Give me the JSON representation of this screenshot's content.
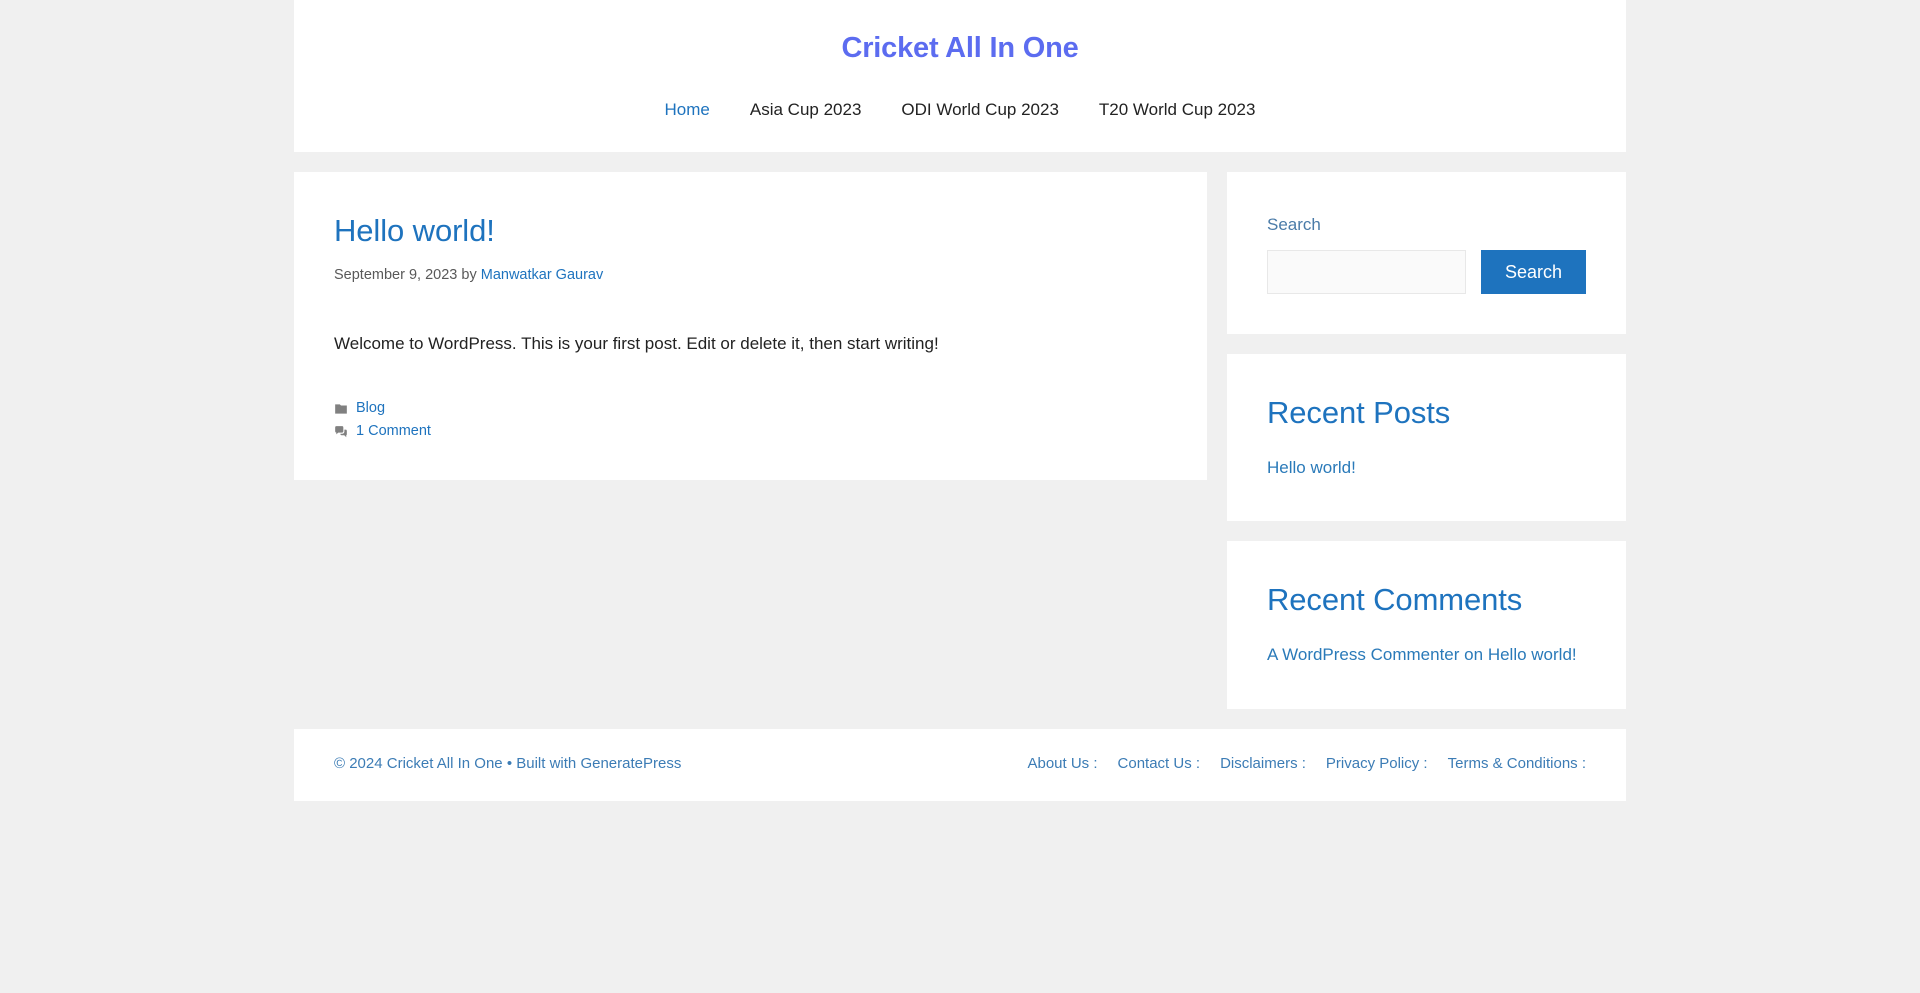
{
  "header": {
    "site_title": "Cricket All In One",
    "nav": [
      {
        "label": "Home",
        "active": true
      },
      {
        "label": "Asia Cup 2023",
        "active": false
      },
      {
        "label": "ODI World Cup 2023",
        "active": false
      },
      {
        "label": "T20 World Cup 2023",
        "active": false
      }
    ]
  },
  "post": {
    "title": "Hello world!",
    "date": "September 9, 2023",
    "by_label": "by",
    "author": "Manwatkar Gaurav",
    "content": "Welcome to WordPress. This is your first post. Edit or delete it, then start writing!",
    "category_icon": "folder-icon",
    "category": "Blog",
    "comments_icon": "comments-icon",
    "comments": "1 Comment"
  },
  "sidebar": {
    "search": {
      "label": "Search",
      "value": "",
      "placeholder": "",
      "button_label": "Search",
      "button_color": "#1e73be"
    },
    "recent_posts": {
      "title": "Recent Posts",
      "items": [
        {
          "label": "Hello world!"
        }
      ]
    },
    "recent_comments": {
      "title": "Recent Comments",
      "items": [
        {
          "author": "A WordPress Commenter",
          "separator": "on",
          "post": "Hello world!"
        }
      ]
    }
  },
  "footer": {
    "copyright": "© 2024 Cricket All In One",
    "bullet": "•",
    "built_with": "Built with",
    "builder": "GeneratePress",
    "nav": [
      {
        "label": "About Us :"
      },
      {
        "label": "Contact Us :"
      },
      {
        "label": "Disclaimers :"
      },
      {
        "label": "Privacy Policy :"
      },
      {
        "label": "Terms & Conditions :"
      }
    ]
  },
  "colors": {
    "site_title": "#5c6cf0",
    "link": "#1e73be",
    "page_background": "#f0f0f0",
    "card_background": "#ffffff"
  }
}
